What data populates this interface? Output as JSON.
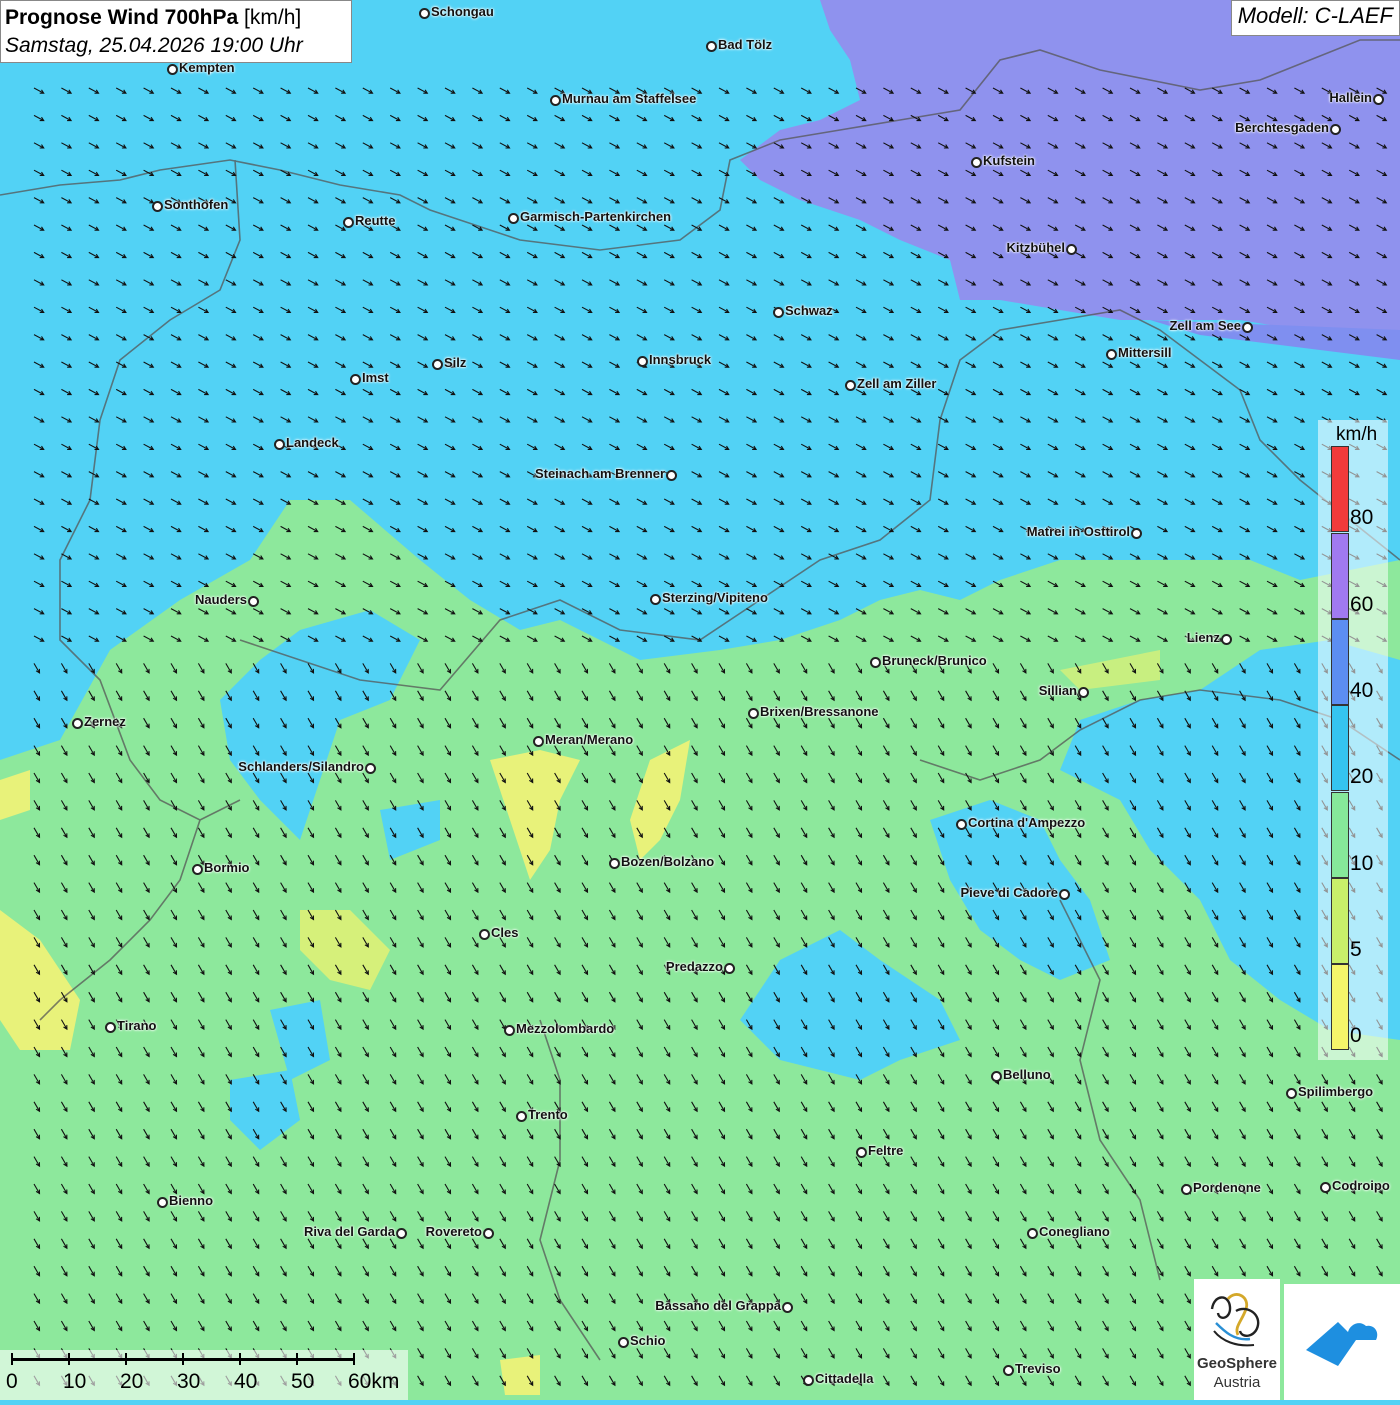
{
  "title": {
    "main": "Prognose Wind 700hPa",
    "unit": "[km/h]",
    "datetime": "Samstag, 25.04.2026 19:00 Uhr"
  },
  "model": "Modell: C-LAEF",
  "legend": {
    "unit": "km/h",
    "labels": [
      "80",
      "60",
      "40",
      "20",
      "10",
      "5",
      "0"
    ],
    "colors": [
      "#f23b3b",
      "#a07af0",
      "#5c8ef2",
      "#35c4f0",
      "#86e89a",
      "#c8f06a",
      "#f5f56a"
    ]
  },
  "scale": {
    "labels": [
      "0",
      "10",
      "20",
      "30",
      "40",
      "50",
      "60km"
    ]
  },
  "logo": {
    "name": "GeoSphere",
    "subtitle": "Austria"
  },
  "cities": [
    {
      "name": "Schongau",
      "label_side": "right"
    },
    {
      "name": "Bad Tölz",
      "label_side": "right"
    },
    {
      "name": "Kempten",
      "label_side": "right"
    },
    {
      "name": "Murnau am Staffelsee",
      "label_side": "right"
    },
    {
      "name": "Hallein",
      "label_side": "left"
    },
    {
      "name": "Berchtesgaden",
      "label_side": "left"
    },
    {
      "name": "Kufstein",
      "label_side": "right"
    },
    {
      "name": "Sonthofen",
      "label_side": "right"
    },
    {
      "name": "Reutte",
      "label_side": "right"
    },
    {
      "name": "Garmisch-Partenkirchen",
      "label_side": "right"
    },
    {
      "name": "Kitzbühel",
      "label_side": "left"
    },
    {
      "name": "Schwaz",
      "label_side": "right"
    },
    {
      "name": "Zell am See",
      "label_side": "left"
    },
    {
      "name": "Mittersill",
      "label_side": "right"
    },
    {
      "name": "Innsbruck",
      "label_side": "right"
    },
    {
      "name": "Silz",
      "label_side": "right"
    },
    {
      "name": "Imst",
      "label_side": "right"
    },
    {
      "name": "Zell am Ziller",
      "label_side": "right"
    },
    {
      "name": "Landeck",
      "label_side": "right"
    },
    {
      "name": "Steinach am Brenner",
      "label_side": "left"
    },
    {
      "name": "Matrei in Osttirol",
      "label_side": "left"
    },
    {
      "name": "Nauders",
      "label_side": "left"
    },
    {
      "name": "Sterzing/Vipiteno",
      "label_side": "right"
    },
    {
      "name": "Lienz",
      "label_side": "left"
    },
    {
      "name": "Bruneck/Brunico",
      "label_side": "right"
    },
    {
      "name": "Sillian",
      "label_side": "left"
    },
    {
      "name": "Zernez",
      "label_side": "right"
    },
    {
      "name": "Brixen/Bressanone",
      "label_side": "right"
    },
    {
      "name": "Meran/Merano",
      "label_side": "right"
    },
    {
      "name": "Schlanders/Silandro",
      "label_side": "left"
    },
    {
      "name": "Cortina d'Ampezzo",
      "label_side": "right"
    },
    {
      "name": "Bozen/Bolzano",
      "label_side": "right"
    },
    {
      "name": "Bormio",
      "label_side": "right"
    },
    {
      "name": "Pieve di Cadore",
      "label_side": "left"
    },
    {
      "name": "Cles",
      "label_side": "right"
    },
    {
      "name": "Predazzo",
      "label_side": "left"
    },
    {
      "name": "Tirano",
      "label_side": "right"
    },
    {
      "name": "Mezzolombardo",
      "label_side": "right"
    },
    {
      "name": "Belluno",
      "label_side": "right"
    },
    {
      "name": "Spilimbergo",
      "label_side": "right"
    },
    {
      "name": "Trento",
      "label_side": "right"
    },
    {
      "name": "Feltre",
      "label_side": "right"
    },
    {
      "name": "Bienno",
      "label_side": "right"
    },
    {
      "name": "Pordenone",
      "label_side": "right"
    },
    {
      "name": "Codroipo",
      "label_side": "right"
    },
    {
      "name": "Riva del Garda",
      "label_side": "left"
    },
    {
      "name": "Rovereto",
      "label_side": "left"
    },
    {
      "name": "Conegliano",
      "label_side": "right"
    },
    {
      "name": "Bassano del Grappa",
      "label_side": "left"
    },
    {
      "name": "Schio",
      "label_side": "right"
    },
    {
      "name": "Treviso",
      "label_side": "right"
    },
    {
      "name": "Cittadella",
      "label_side": "right"
    }
  ]
}
